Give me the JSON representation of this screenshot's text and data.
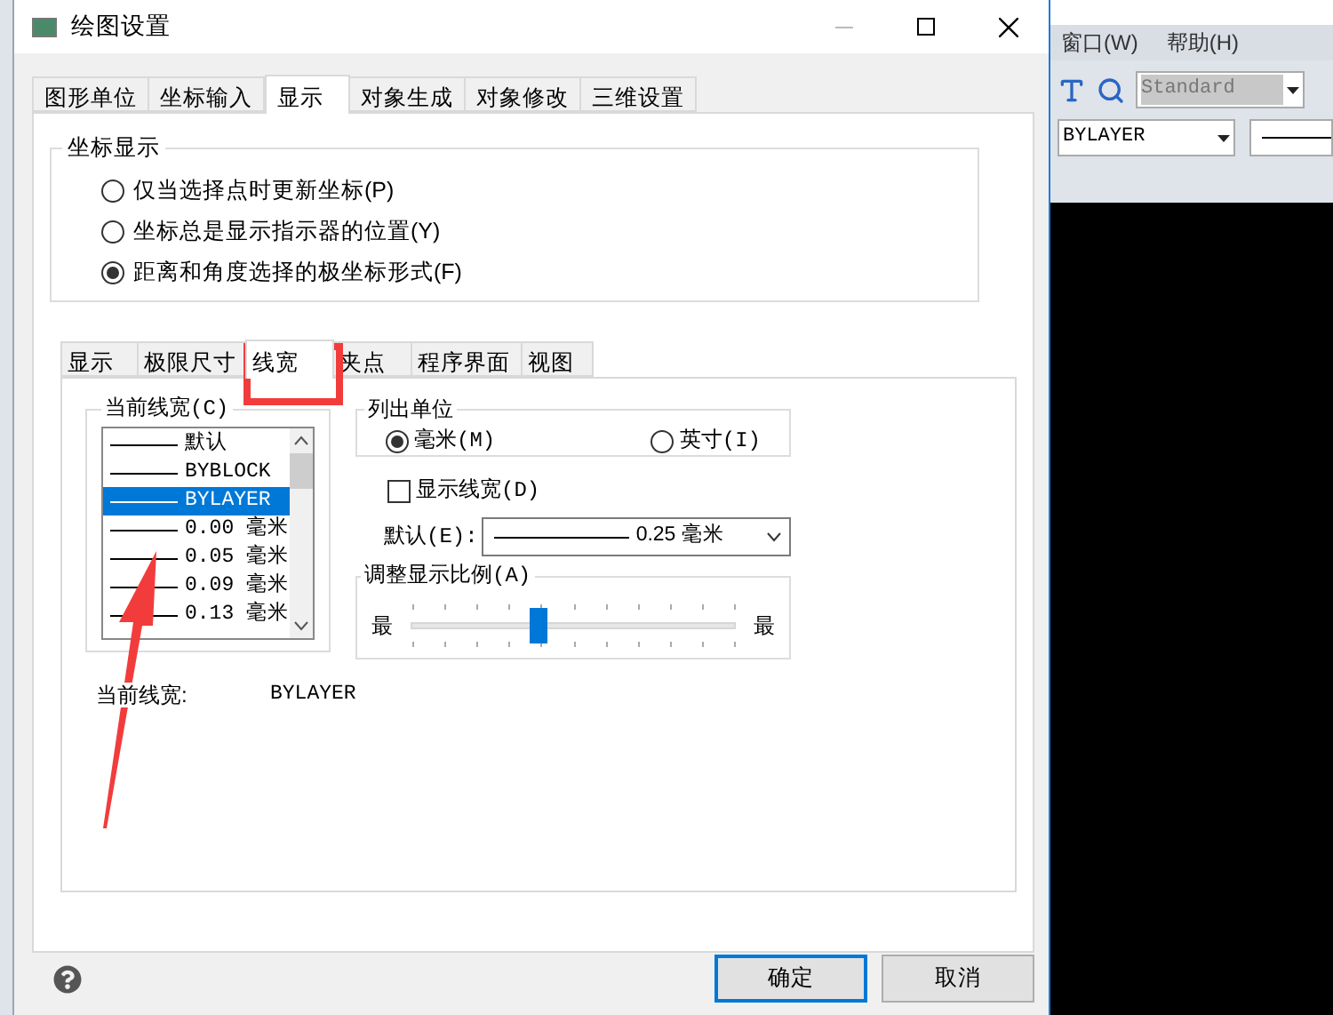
{
  "dialog": {
    "title": "绘图设置",
    "tabs": [
      {
        "label": "图形单位",
        "selected": false
      },
      {
        "label": "坐标输入",
        "selected": false
      },
      {
        "label": "显示",
        "selected": true
      },
      {
        "label": "对象生成",
        "selected": false
      },
      {
        "label": "对象修改",
        "selected": false
      },
      {
        "label": "三维设置",
        "selected": false
      }
    ],
    "coordinate_group": {
      "title": "坐标显示",
      "options": [
        {
          "label": "仅当选择点时更新坐标(P)",
          "selected": false
        },
        {
          "label": "坐标总是显示指示器的位置(Y)",
          "selected": false
        },
        {
          "label": "距离和角度选择的极坐标形式(F)",
          "selected": true
        }
      ]
    },
    "inner_tabs": [
      {
        "label": "显示",
        "selected": false
      },
      {
        "label": "极限尺寸",
        "selected": false
      },
      {
        "label": "线宽",
        "selected": true
      },
      {
        "label": "夹点",
        "selected": false
      },
      {
        "label": "程序界面",
        "selected": false
      },
      {
        "label": "视图",
        "selected": false
      }
    ],
    "lineweight_group": {
      "title": "当前线宽(C)",
      "items": [
        {
          "label": "默认",
          "selected": false
        },
        {
          "label": "BYBLOCK",
          "selected": false
        },
        {
          "label": "BYLAYER",
          "selected": true
        },
        {
          "label": "0.00 毫米",
          "selected": false
        },
        {
          "label": "0.05 毫米",
          "selected": false
        },
        {
          "label": "0.09 毫米",
          "selected": false
        },
        {
          "label": "0.13 毫米",
          "selected": false
        }
      ]
    },
    "units_group": {
      "title": "列出单位",
      "options": [
        {
          "label": "毫米(M)",
          "selected": true
        },
        {
          "label": "英寸(I)",
          "selected": false
        }
      ]
    },
    "show_lineweight": {
      "label": "显示线宽(D)",
      "checked": false
    },
    "default_weight": {
      "label": "默认(E):",
      "value": "0.25 毫米"
    },
    "scale_group": {
      "title": "调整显示比例(A)",
      "min_label": "最",
      "max_label": "最",
      "level": 0.39
    },
    "current": {
      "label": "当前线宽:",
      "value": "BYLAYER"
    },
    "buttons": [
      {
        "label": "确定",
        "default": true
      },
      {
        "label": "取消",
        "default": false
      }
    ]
  },
  "background_app": {
    "menu": [
      "窗口(W)",
      "帮助(H)"
    ],
    "style_dropdown": "Standard",
    "layer_dropdown": "BYLAYER"
  }
}
